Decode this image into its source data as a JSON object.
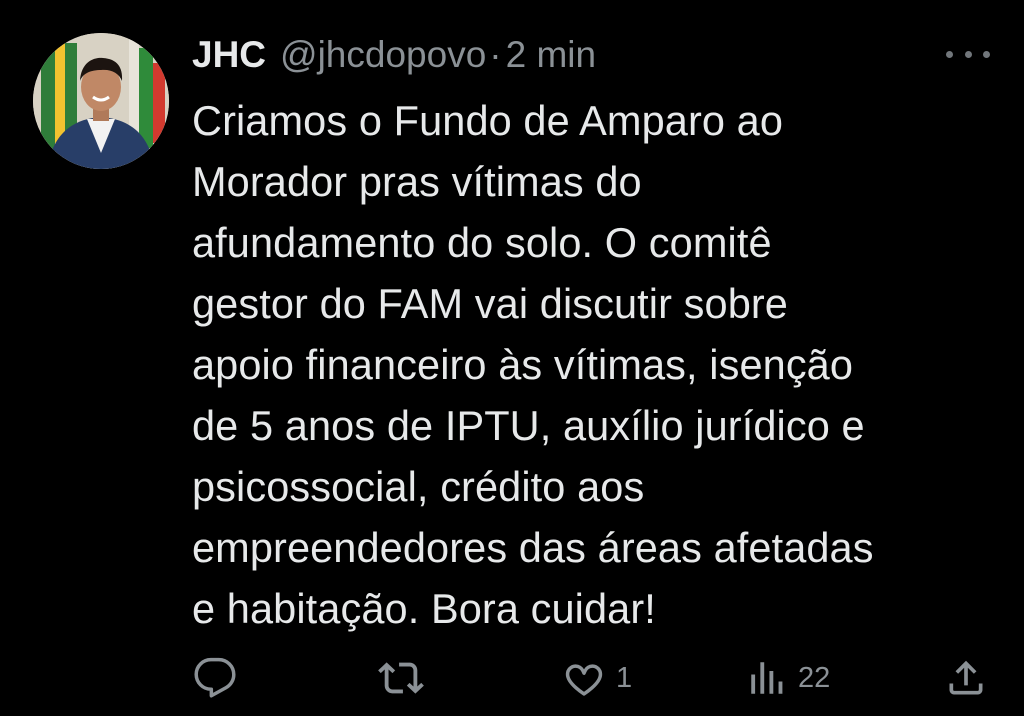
{
  "tweet": {
    "author_name": "JHC",
    "handle": "@jhcdopovo",
    "separator": "·",
    "time": "2 min",
    "text": "Criamos o Fundo de Amparo ao\nMorador pras vítimas do\nafundamento do solo. O  comitê\ngestor do FAM vai discutir sobre\napoio financeiro às vítimas, isenção\nde 5 anos de IPTU, auxílio jurídico e\npsicossocial, crédito aos\nempreendedores das áreas afetadas\ne habitação. Bora cuidar!"
  },
  "actions": {
    "reply": {
      "icon": "reply-icon",
      "count": ""
    },
    "retweet": {
      "icon": "retweet-icon",
      "count": ""
    },
    "like": {
      "icon": "heart-icon",
      "count": "1"
    },
    "views": {
      "icon": "views-icon",
      "count": "22"
    },
    "share": {
      "icon": "share-icon"
    }
  },
  "colors": {
    "background": "#000000",
    "primary_text": "#e7e9ea",
    "secondary_text": "#8b9196"
  }
}
